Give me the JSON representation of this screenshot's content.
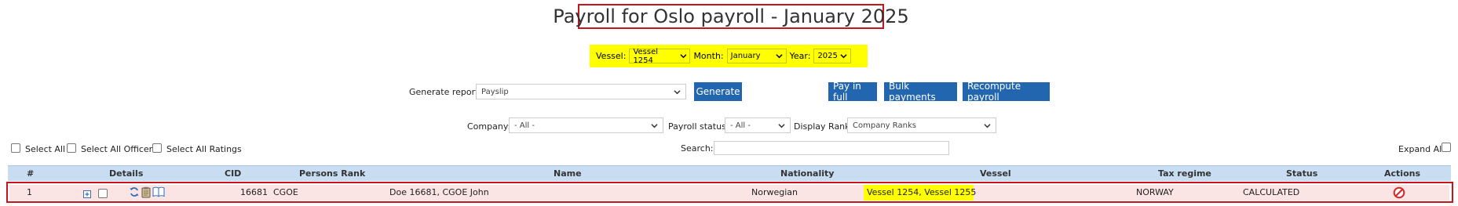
{
  "page": {
    "title": "Payroll for Oslo payroll - January 2025"
  },
  "filters": {
    "vessel_label": "Vessel:",
    "vessel_value": "Vessel 1254",
    "month_label": "Month:",
    "month_value": "January",
    "year_label": "Year:",
    "year_value": "2025",
    "highlight_color": "#ffff00"
  },
  "report": {
    "label": "Generate report:",
    "value": "Payslip",
    "generate_label": "Generate",
    "pay_in_full_label": "Pay in full",
    "bulk_payments_label": "Bulk payments",
    "recompute_label": "Recompute payroll",
    "button_color": "#2266b0"
  },
  "secondary_filters": {
    "company_label": "Company:",
    "company_value": "- All -",
    "payroll_status_label": "Payroll status:",
    "payroll_status_value": "- All -",
    "display_rank_label": "Display Rank:",
    "display_rank_value": "Company Ranks"
  },
  "selection": {
    "select_all": "Select All",
    "select_all_officers": "Select All Officers",
    "select_all_ratings": "Select All Ratings",
    "search_label": "Search:",
    "search_value": "",
    "expand_all": "Expand All"
  },
  "table": {
    "headers": {
      "num": "#",
      "details": "Details",
      "cid": "CID",
      "persons_rank": "Persons Rank",
      "name": "Name",
      "nationality": "Nationality",
      "vessel": "Vessel",
      "tax_regime": "Tax regime",
      "status": "Status",
      "actions": "Actions"
    },
    "rows": [
      {
        "num": "1",
        "expand_icon": "plus-square-icon",
        "cid": "16681",
        "persons_rank": "CGOE",
        "name": "Doe 16681, CGOE John",
        "nationality": "Norwegian",
        "vessel": "Vessel 1254, Vessel 1255",
        "tax_regime": "NORWAY",
        "status": "CALCULATED",
        "action_icon": "cancel-icon"
      }
    ],
    "header_color": "#c8ddf2",
    "row_color": "#fbe4e4",
    "highlight_border_color": "#c8151c"
  }
}
